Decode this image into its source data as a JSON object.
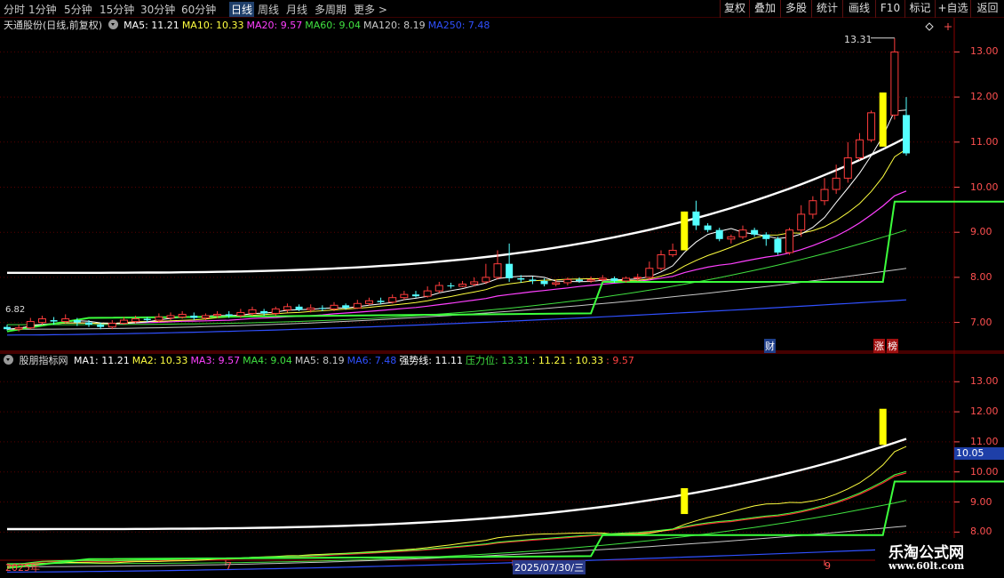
{
  "toolbar": {
    "periods": [
      "分时",
      "1分钟",
      "5分钟",
      "15分钟",
      "30分钟",
      "60分钟",
      "日线",
      "周线",
      "月线",
      "多周期",
      "更多 >"
    ],
    "active_period": "日线",
    "buttons": [
      "复权",
      "叠加",
      "多股",
      "统计",
      "画线",
      "F10",
      "标记",
      "+自选",
      "返回"
    ]
  },
  "main_legend": {
    "title": "天通股份(日线,前复权)",
    "items": [
      {
        "label": "MA5: 11.21",
        "color": "#ffffff"
      },
      {
        "label": "MA10: 10.33",
        "color": "#ffff40"
      },
      {
        "label": "MA20: 9.57",
        "color": "#ff40ff"
      },
      {
        "label": "MA60: 9.04",
        "color": "#40e040"
      },
      {
        "label": "MA120: 8.19",
        "color": "#c8c8c8"
      },
      {
        "label": "MA250: 7.48",
        "color": "#3050ff"
      }
    ],
    "peak_label": "13.31",
    "low_label": "6.82"
  },
  "sub_legend": {
    "title": "股朋指标网",
    "items": [
      {
        "label": "MA1: 11.21",
        "color": "#ffffff"
      },
      {
        "label": "MA2: 10.33",
        "color": "#ffff40"
      },
      {
        "label": "MA3: 9.57",
        "color": "#ff40ff"
      },
      {
        "label": "MA4: 9.04",
        "color": "#40e040"
      },
      {
        "label": "MA5: 8.19",
        "color": "#c8c8c8"
      },
      {
        "label": "MA6: 7.48",
        "color": "#3050ff"
      },
      {
        "label": "强势线: 11.11",
        "color": "#ffffff"
      },
      {
        "label": "压力位: 13.31",
        "color": "#40e040"
      },
      {
        "label": ": 11.21",
        "color": "#ffff40"
      },
      {
        "label": ": 10.33",
        "color": "#ffff40"
      },
      {
        "label": ": 9.57",
        "color": "#ff4040"
      }
    ]
  },
  "main_axis": [
    "13.00",
    "12.00",
    "11.00",
    "10.00",
    "9.00",
    "8.00",
    "7.00"
  ],
  "sub_axis": [
    "13.00",
    "12.00",
    "11.00",
    "10.00",
    "9.00",
    "8.00"
  ],
  "sub_current": "10.05",
  "x_axis": {
    "labels": [
      "2025年",
      "7",
      "2025/07/30/三",
      "9"
    ],
    "selected": "2025/07/30/三"
  },
  "markers": {
    "finance": "财",
    "limit_up": "涨",
    "list": "榜"
  },
  "watermark": {
    "line1": "乐淘公式网",
    "line2": "www.60lt.com"
  },
  "colors": {
    "up": "#ff3c3c",
    "down": "#54ffff",
    "limit_up": "#ffff00",
    "pressure": "#3cff3c",
    "grid": "#5a0000"
  },
  "chart_data": {
    "type": "candlestick",
    "scale_note": "main pane y axis in price",
    "ylim": [
      6.4,
      13.6
    ],
    "candles": [
      [
        6.9,
        6.85,
        6.95,
        6.82
      ],
      [
        6.85,
        6.88,
        6.95,
        6.8
      ],
      [
        6.88,
        7.02,
        7.1,
        6.85
      ],
      [
        7.0,
        7.08,
        7.15,
        6.95
      ],
      [
        7.05,
        7.02,
        7.12,
        6.95
      ],
      [
        7.02,
        7.08,
        7.18,
        6.98
      ],
      [
        7.05,
        7.0,
        7.1,
        6.92
      ],
      [
        7.0,
        6.95,
        7.05,
        6.9
      ],
      [
        6.95,
        6.9,
        7.0,
        6.85
      ],
      [
        6.9,
        6.98,
        7.05,
        6.85
      ],
      [
        6.98,
        7.05,
        7.12,
        6.95
      ],
      [
        7.02,
        7.08,
        7.15,
        6.98
      ],
      [
        7.08,
        7.05,
        7.12,
        7.0
      ],
      [
        7.05,
        7.12,
        7.2,
        7.0
      ],
      [
        7.1,
        7.15,
        7.22,
        7.05
      ],
      [
        7.12,
        7.18,
        7.25,
        7.08
      ],
      [
        7.15,
        7.1,
        7.22,
        7.05
      ],
      [
        7.1,
        7.15,
        7.2,
        7.05
      ],
      [
        7.15,
        7.18,
        7.25,
        7.1
      ],
      [
        7.18,
        7.15,
        7.25,
        7.1
      ],
      [
        7.15,
        7.22,
        7.3,
        7.1
      ],
      [
        7.2,
        7.28,
        7.35,
        7.15
      ],
      [
        7.25,
        7.2,
        7.3,
        7.15
      ],
      [
        7.2,
        7.3,
        7.35,
        7.15
      ],
      [
        7.28,
        7.35,
        7.42,
        7.22
      ],
      [
        7.35,
        7.28,
        7.4,
        7.25
      ],
      [
        7.28,
        7.32,
        7.4,
        7.22
      ],
      [
        7.32,
        7.3,
        7.38,
        7.25
      ],
      [
        7.3,
        7.38,
        7.45,
        7.25
      ],
      [
        7.38,
        7.32,
        7.42,
        7.28
      ],
      [
        7.32,
        7.42,
        7.5,
        7.3
      ],
      [
        7.42,
        7.48,
        7.55,
        7.38
      ],
      [
        7.48,
        7.45,
        7.55,
        7.4
      ],
      [
        7.45,
        7.55,
        7.62,
        7.42
      ],
      [
        7.55,
        7.62,
        7.7,
        7.5
      ],
      [
        7.62,
        7.58,
        7.7,
        7.55
      ],
      [
        7.58,
        7.7,
        7.8,
        7.55
      ],
      [
        7.7,
        7.82,
        7.9,
        7.65
      ],
      [
        7.82,
        7.8,
        7.88,
        7.75
      ],
      [
        7.8,
        7.85,
        7.92,
        7.78
      ],
      [
        7.85,
        7.9,
        8.0,
        7.8
      ],
      [
        7.9,
        8.0,
        8.3,
        7.85
      ],
      [
        8.0,
        8.3,
        8.6,
        7.95
      ],
      [
        8.3,
        7.98,
        8.75,
        7.9
      ],
      [
        7.98,
        7.95,
        8.05,
        7.88
      ],
      [
        7.95,
        7.92,
        8.02,
        7.85
      ],
      [
        7.92,
        7.85,
        7.98,
        7.8
      ],
      [
        7.85,
        7.88,
        7.95,
        7.8
      ],
      [
        7.88,
        7.95,
        8.0,
        7.82
      ],
      [
        7.95,
        7.92,
        8.0,
        7.88
      ],
      [
        7.92,
        7.95,
        8.02,
        7.88
      ],
      [
        7.95,
        7.98,
        8.05,
        7.9
      ],
      [
        7.98,
        7.92,
        8.02,
        7.88
      ],
      [
        7.92,
        7.98,
        8.02,
        7.88
      ],
      [
        7.98,
        8.0,
        8.08,
        7.92
      ],
      [
        8.0,
        8.2,
        8.35,
        7.95
      ],
      [
        8.2,
        8.5,
        8.6,
        8.15
      ],
      [
        8.5,
        8.6,
        8.75,
        8.45
      ],
      [
        8.6,
        9.46,
        9.46,
        8.6
      ],
      [
        9.46,
        9.15,
        9.7,
        9.05
      ],
      [
        9.15,
        9.05,
        9.2,
        9.0
      ],
      [
        9.05,
        8.85,
        9.1,
        8.8
      ],
      [
        8.85,
        8.9,
        8.95,
        8.75
      ],
      [
        8.9,
        9.05,
        9.15,
        8.85
      ],
      [
        9.05,
        8.95,
        9.1,
        8.9
      ],
      [
        8.95,
        8.85,
        9.0,
        8.7
      ],
      [
        8.85,
        8.55,
        8.9,
        8.5
      ],
      [
        8.55,
        9.05,
        9.1,
        8.5
      ],
      [
        9.05,
        9.4,
        9.6,
        8.9
      ],
      [
        9.4,
        9.7,
        9.8,
        9.3
      ],
      [
        9.7,
        9.95,
        10.2,
        9.6
      ],
      [
        9.95,
        10.2,
        10.5,
        9.85
      ],
      [
        10.2,
        10.65,
        11.0,
        10.1
      ],
      [
        10.65,
        11.05,
        11.2,
        10.6
      ],
      [
        11.05,
        11.65,
        11.7,
        11.0
      ],
      [
        10.9,
        12.1,
        12.1,
        10.9
      ],
      [
        11.6,
        13.0,
        13.31,
        11.5
      ],
      [
        11.6,
        10.75,
        12.0,
        10.7
      ]
    ],
    "pressure_line": [
      [
        0,
        6.8
      ],
      [
        7,
        7.1
      ],
      [
        50,
        7.2
      ],
      [
        51,
        7.9
      ],
      [
        75,
        7.9
      ],
      [
        76,
        9.68
      ],
      [
        97,
        9.68
      ],
      [
        98,
        13.31
      ],
      [
        100,
        13.31
      ]
    ]
  }
}
